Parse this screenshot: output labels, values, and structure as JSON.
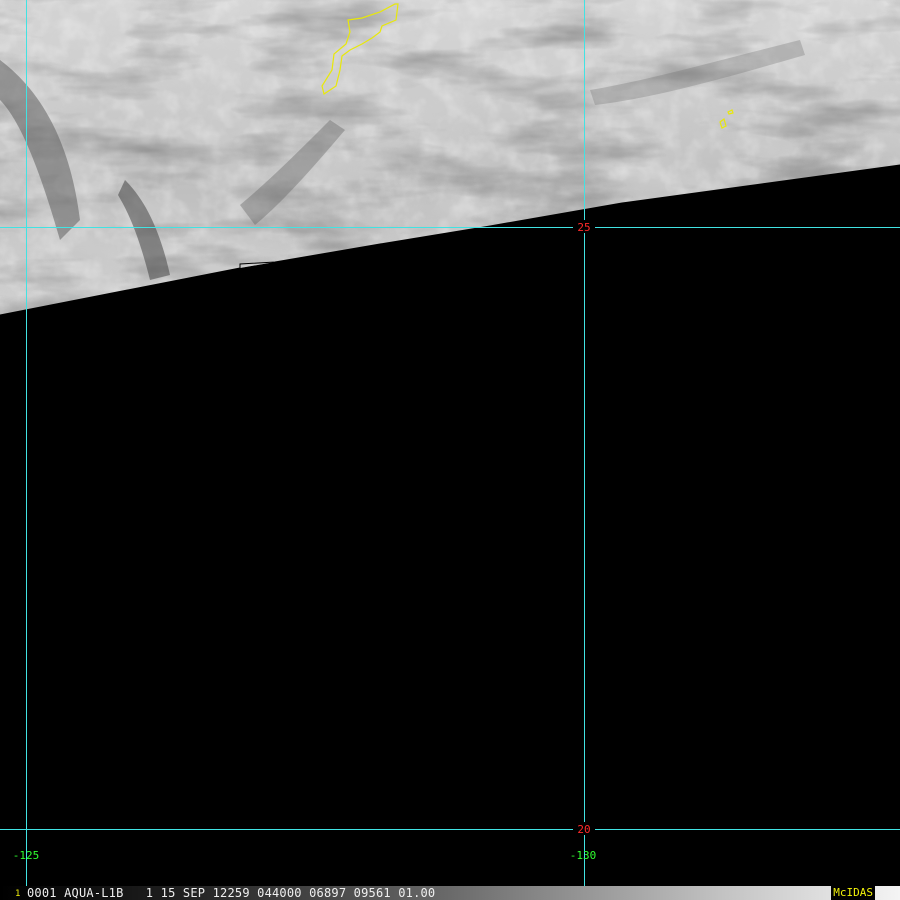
{
  "map": {
    "colors": {
      "background": "#000000",
      "grid": "#41e3e3",
      "coastline": "#e8e80a",
      "latitude_label": "#ff2a2a",
      "longitude_label": "#2fff2f",
      "status_brand": "#f2f20a"
    },
    "latitude_labels": [
      "25",
      "20"
    ],
    "longitude_labels": [
      "-125",
      "-130"
    ]
  },
  "status_bar": {
    "frame_number": "1",
    "info_text": "0001 AQUA-L1B   1 15 SEP 12259 044000 06897 09561 01.00",
    "brand": "McIDAS"
  }
}
